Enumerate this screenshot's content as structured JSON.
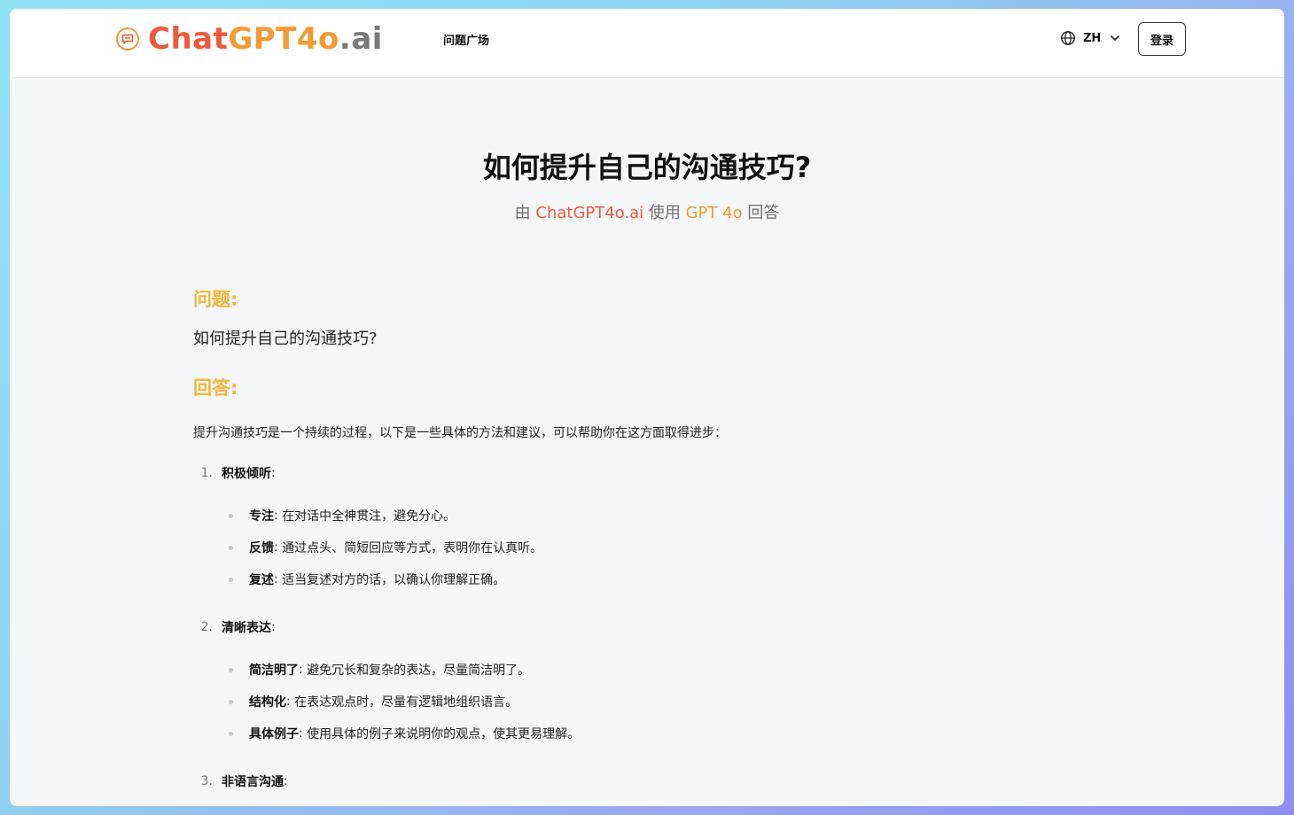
{
  "header": {
    "logo": {
      "part1": "Chat",
      "part2": "GPT4o",
      "part3": ".ai"
    },
    "nav_link": "问题广场",
    "language": "ZH",
    "login": "登录"
  },
  "article": {
    "title": "如何提升自己的沟通技巧?",
    "byline": {
      "prefix": "由",
      "brand": "ChatGPT4o.ai",
      "middle": "使用",
      "model": "GPT 4o",
      "suffix": "回答"
    },
    "question_heading": "问题:",
    "question_text": "如何提升自己的沟通技巧?",
    "answer_heading": "回答:",
    "intro": "提升沟通技巧是一个持续的过程，以下是一些具体的方法和建议，可以帮助你在这方面取得进步：",
    "sections": [
      {
        "number": "1.",
        "title": "积极倾听",
        "items": [
          {
            "term": "专注",
            "text": "在对话中全神贯注，避免分心。"
          },
          {
            "term": "反馈",
            "text": "通过点头、简短回应等方式，表明你在认真听。"
          },
          {
            "term": "复述",
            "text": "适当复述对方的话，以确认你理解正确。"
          }
        ]
      },
      {
        "number": "2.",
        "title": "清晰表达",
        "items": [
          {
            "term": "简洁明了",
            "text": "避免冗长和复杂的表达，尽量简洁明了。"
          },
          {
            "term": "结构化",
            "text": "在表达观点时，尽量有逻辑地组织语言。"
          },
          {
            "term": "具体例子",
            "text": "使用具体的例子来说明你的观点，使其更易理解。"
          }
        ]
      },
      {
        "number": "3.",
        "title": "非语言沟通",
        "items": []
      }
    ]
  },
  "colors": {
    "brand_red": "#ee5a3c",
    "brand_orange": "#f39a34",
    "heading_yellow": "#f4b63a"
  },
  "icons": {
    "logo": "chat-bubble-icon",
    "language": "globe-icon",
    "dropdown": "chevron-down-icon"
  }
}
